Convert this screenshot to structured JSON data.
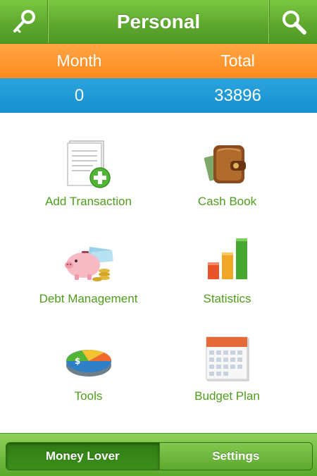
{
  "header": {
    "title": "Personal",
    "left_icon": "key-icon",
    "right_icon": "search-icon"
  },
  "summary": {
    "month_label": "Month",
    "total_label": "Total",
    "month_value": "0",
    "total_value": "33896"
  },
  "menu": [
    {
      "label": "Add Transaction",
      "icon": "add-transaction-icon"
    },
    {
      "label": "Cash Book",
      "icon": "wallet-icon"
    },
    {
      "label": "Debt Management",
      "icon": "piggy-bank-icon"
    },
    {
      "label": "Statistics",
      "icon": "bar-chart-icon"
    },
    {
      "label": "Tools",
      "icon": "pie-chart-icon"
    },
    {
      "label": "Budget Plan",
      "icon": "calendar-icon"
    }
  ],
  "tabbar": {
    "tabs": [
      {
        "label": "Money Lover",
        "active": true
      },
      {
        "label": "Settings",
        "active": false
      }
    ]
  },
  "colors": {
    "header_green": "#5fa82f",
    "orange": "#ff8a1f",
    "blue": "#1690cf",
    "label_green": "#4e9d1d"
  }
}
